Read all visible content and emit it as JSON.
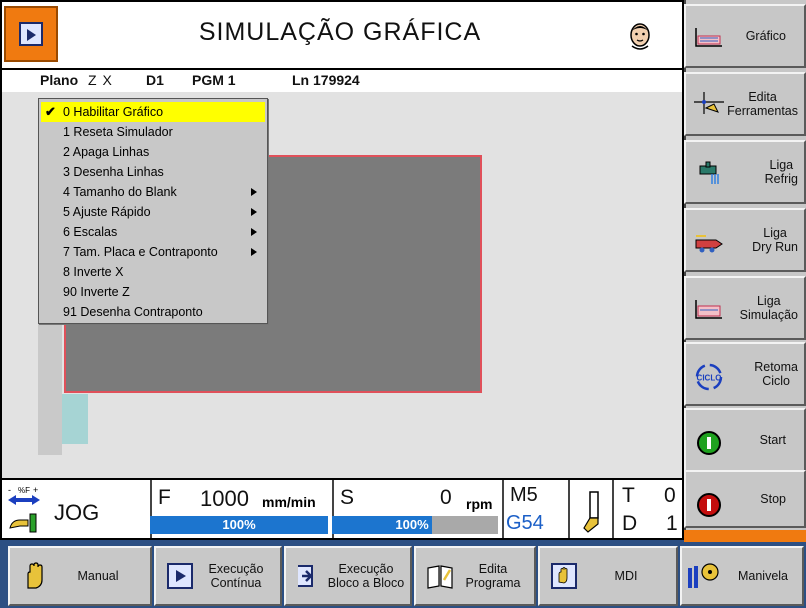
{
  "title": "SIMULAÇÃO GRÁFICA",
  "status": {
    "plano_label": "Plano",
    "plano_value": "Z X",
    "tool": "D1",
    "program": "PGM 1",
    "line": "Ln 179924"
  },
  "menu": {
    "items": [
      {
        "label": "0 Habilitar Gráfico",
        "checked": true,
        "submenu": false
      },
      {
        "label": "1 Reseta Simulador",
        "checked": false,
        "submenu": false
      },
      {
        "label": "2 Apaga Linhas",
        "checked": false,
        "submenu": false
      },
      {
        "label": "3 Desenha Linhas",
        "checked": false,
        "submenu": false
      },
      {
        "label": "4 Tamanho do Blank",
        "checked": false,
        "submenu": true
      },
      {
        "label": "5 Ajuste Rápido",
        "checked": false,
        "submenu": true
      },
      {
        "label": "6 Escalas",
        "checked": false,
        "submenu": true
      },
      {
        "label": "7 Tam. Placa e Contraponto",
        "checked": false,
        "submenu": true
      },
      {
        "label": "8 Inverte X",
        "checked": false,
        "submenu": false
      },
      {
        "label": "90 Inverte Z",
        "checked": false,
        "submenu": false
      },
      {
        "label": "91 Desenha Contraponto",
        "checked": false,
        "submenu": false
      }
    ],
    "check_glyph": "✔"
  },
  "info": {
    "override_label": "%F",
    "mode": "JOG",
    "feed_letter": "F",
    "feed_value": "1000",
    "feed_unit": "mm/min",
    "feed_override": "100%",
    "feed_override_fraction": 1.0,
    "spindle_letter": "S",
    "spindle_value": "0",
    "spindle_unit": "rpm",
    "spindle_override": "100%",
    "spindle_override_fraction": 1.0,
    "mcode": "M5",
    "work_offset": "G54",
    "t_letter": "T",
    "t_value": "0",
    "d_letter": "D",
    "d_value": "1"
  },
  "right_buttons": [
    {
      "label": "Gráfico",
      "icon": "chart-icon"
    },
    {
      "label": "Edita\nFerramentas",
      "icon": "tool-edit-icon"
    },
    {
      "label": "Liga\nRefrig",
      "icon": "coolant-icon"
    },
    {
      "label": "Liga\nDry Run",
      "icon": "dry-run-icon"
    },
    {
      "label": "Liga\nSimulação",
      "icon": "simulation-icon"
    },
    {
      "label": "Retoma\nCiclo",
      "icon": "cycle-icon",
      "icon_text": "CICLO"
    },
    {
      "label": "Start",
      "icon": "start-icon"
    },
    {
      "label": "Stop",
      "icon": "stop-icon"
    }
  ],
  "bottom_buttons": [
    {
      "label": "Manual",
      "icon": "hand-icon"
    },
    {
      "label": "Execução\nContínua",
      "icon": "continuous-run-icon"
    },
    {
      "label": "Execução\nBloco a Bloco",
      "icon": "block-run-icon"
    },
    {
      "label": "Edita\nPrograma",
      "icon": "edit-program-icon"
    },
    {
      "label": "MDI",
      "icon": "mdi-icon"
    },
    {
      "label": "Manivela",
      "icon": "handwheel-icon"
    }
  ],
  "colors": {
    "accent_orange": "#f07a10",
    "progress_blue": "#1c75cf",
    "menu_highlight": "#ffff00",
    "start_green": "#1fa21f",
    "stop_red": "#c40e0e",
    "blank_outline": "#e0505a"
  }
}
